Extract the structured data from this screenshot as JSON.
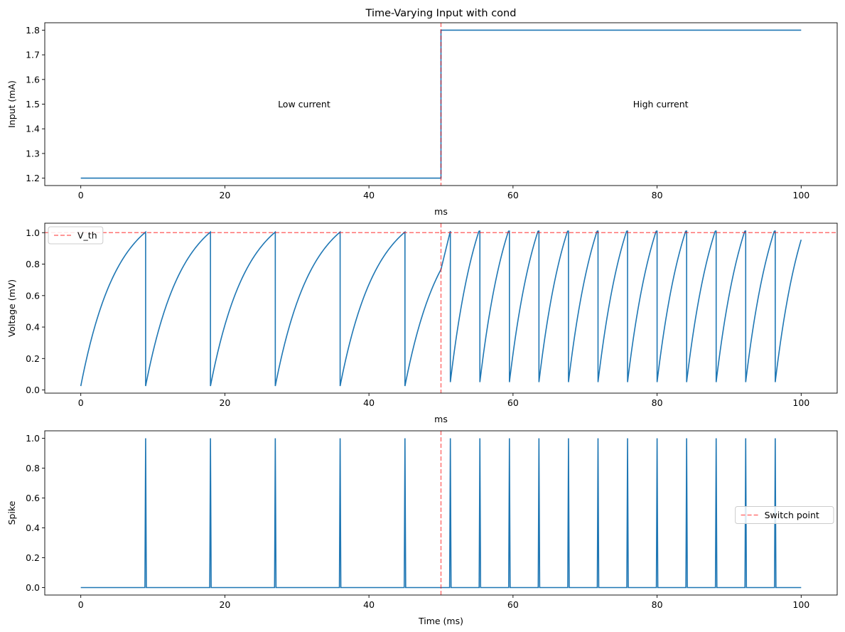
{
  "chart_data": [
    {
      "type": "line",
      "title": "Time-Varying Input with cond",
      "xlabel": "ms",
      "ylabel": "Input (mA)",
      "xlim": [
        -5,
        105
      ],
      "ylim": [
        1.17,
        1.83
      ],
      "xticks": [
        0,
        20,
        40,
        60,
        80,
        100
      ],
      "yticks": [
        1.2,
        1.3,
        1.4,
        1.5,
        1.6,
        1.7,
        1.8
      ],
      "ytick_labels": [
        "1.2",
        "1.3",
        "1.4",
        "1.5",
        "1.6",
        "1.7",
        "1.8"
      ],
      "series": [
        {
          "x": [
            0,
            50,
            50,
            100
          ],
          "y": [
            1.2,
            1.2,
            1.8,
            1.8
          ],
          "color": "#1f77b4"
        }
      ],
      "vlines": [
        {
          "x": 50,
          "color": "#ff0000",
          "style": "dashed"
        }
      ],
      "annotations": [
        {
          "text": "Low current",
          "x": 31,
          "y": 1.5
        },
        {
          "text": "High current",
          "x": 80.5,
          "y": 1.5
        }
      ],
      "grid": false
    },
    {
      "type": "line",
      "title": "",
      "xlabel": "ms",
      "ylabel": "Voltage (mV)",
      "xlim": [
        -5,
        105
      ],
      "ylim": [
        -0.02,
        1.06
      ],
      "xticks": [
        0,
        20,
        40,
        60,
        80,
        100
      ],
      "yticks": [
        0,
        0.2,
        0.4,
        0.6,
        0.8,
        1.0
      ],
      "ytick_labels": [
        "0.0",
        "0.2",
        "0.4",
        "0.6",
        "0.8",
        "1.0"
      ],
      "model": {
        "low_input": 1.2,
        "high_input": 1.8,
        "switch_time": 50,
        "low_spike_times": [
          9,
          18,
          27,
          36,
          45
        ],
        "high_spike_times": [
          51.3,
          55.4,
          59.5,
          63.6,
          67.7,
          71.8,
          75.9,
          80.0,
          84.1,
          88.2,
          92.3,
          96.4
        ],
        "reset_low": 0.025,
        "reset_high": 0.05,
        "end_value": 0.91,
        "end_time": 100
      },
      "hlines": [
        {
          "y": 1.0,
          "color": "#ff0000",
          "style": "dashed",
          "label": "V_th"
        }
      ],
      "vlines": [
        {
          "x": 50,
          "color": "#ff0000",
          "style": "dashed"
        }
      ],
      "legend": {
        "entries": [
          "V_th"
        ],
        "position": "upper-left"
      },
      "grid": false,
      "color": "#1f77b4"
    },
    {
      "type": "line",
      "title": "",
      "xlabel": "Time (ms)",
      "ylabel": "Spike",
      "xlim": [
        -5,
        105
      ],
      "ylim": [
        -0.05,
        1.05
      ],
      "xticks": [
        0,
        20,
        40,
        60,
        80,
        100
      ],
      "yticks": [
        0,
        0.2,
        0.4,
        0.6,
        0.8,
        1.0
      ],
      "ytick_labels": [
        "0.0",
        "0.2",
        "0.4",
        "0.6",
        "0.8",
        "1.0"
      ],
      "spike_times": [
        9,
        18,
        27,
        36,
        45,
        51.3,
        55.4,
        59.5,
        63.6,
        67.7,
        71.8,
        75.9,
        80.0,
        84.1,
        88.2,
        92.3,
        96.4
      ],
      "vlines": [
        {
          "x": 50,
          "color": "#ff0000",
          "style": "dashed",
          "label": "Switch point"
        }
      ],
      "legend": {
        "entries": [
          "Switch point"
        ],
        "position": "center-right"
      },
      "grid": false,
      "color": "#1f77b4"
    }
  ]
}
